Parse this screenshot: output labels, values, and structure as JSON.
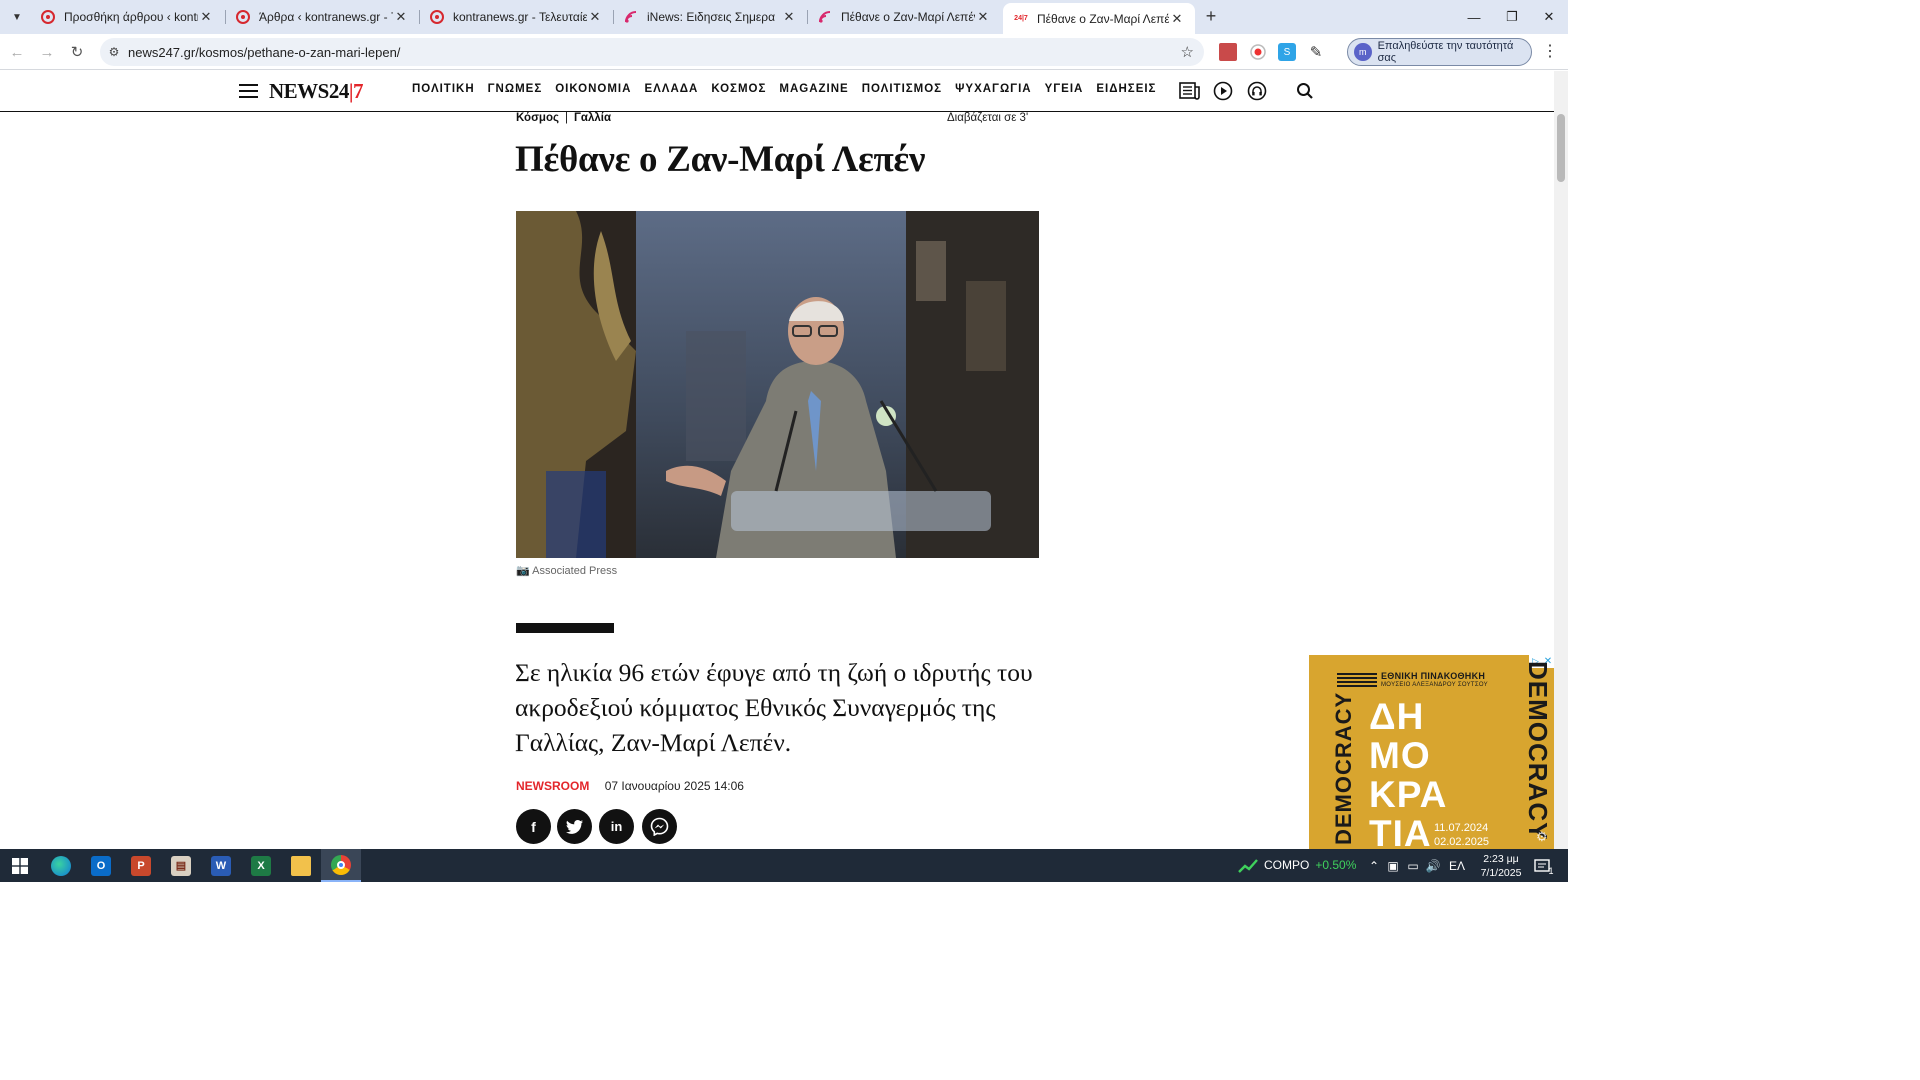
{
  "browser": {
    "tabs": [
      {
        "title": "Προσθήκη άρθρου ‹ kontranews.gr",
        "favicon": "kontranews-icon",
        "active": false
      },
      {
        "title": "Άρθρα ‹ kontranews.gr - Τελευταίες",
        "favicon": "kontranews-icon",
        "active": false
      },
      {
        "title": "kontranews.gr - Τελευταίες ειδήσεις",
        "favicon": "kontranews-icon",
        "active": false
      },
      {
        "title": "iNews: Ειδησεις Σημερα",
        "favicon": "inews-icon",
        "active": false
      },
      {
        "title": "Πέθανε ο Ζαν-Μαρί Λεπέν - ρεπορτάζ",
        "favicon": "inews-icon",
        "active": false
      },
      {
        "title": "Πέθανε ο Ζαν-Μαρί Λεπέν",
        "favicon": "news247-icon",
        "active": true
      }
    ],
    "url": "news247.gr/kosmos/pethane-o-zan-mari-lepen/",
    "verify_identity": "Επαληθεύστε την ταυτότητά σας"
  },
  "site": {
    "logo_main": "NEWS24",
    "logo_accent": "|7",
    "nav": [
      "ΠΟΛΙΤΙΚΗ",
      "ΓΝΩΜΕΣ",
      "ΟΙΚΟΝΟΜΙΑ",
      "ΕΛΛΑΔΑ",
      "ΚΟΣΜΟΣ",
      "MAGAZINE",
      "ΠΟΛΙΤΙΣΜΟΣ",
      "ΨΥΧΑΓΩΓΙΑ",
      "ΥΓΕΙΑ",
      "ΕΙΔΗΣΕΙΣ"
    ]
  },
  "article": {
    "category": "Κόσμος",
    "subcategory": "Γαλλία",
    "read_time": "Διαβάζεται σε 3'",
    "headline": "Πέθανε ο Ζαν-Μαρί Λεπέν",
    "photo_credit": "Associated Press",
    "lead": "Σε ηλικία 96 ετών έφυγε από τη ζωή ο ιδρυτής του ακροδεξιού κόμματος Εθνικός Συναγερμός της Γαλλίας, Ζαν-Μαρί Λεπέν.",
    "author": "NEWSROOM",
    "date": "07 Ιανουαρίου 2025 14:06",
    "share": [
      "facebook",
      "twitter",
      "linkedin",
      "messenger"
    ]
  },
  "ad": {
    "museum_name": "ΕΘΝΙΚΗ ΠΙΝΑΚΟΘΗΚΗ",
    "museum_sub": "ΜΟΥΣΕΙΟ ΑΛΕΞΑΝΔΡΟΥ ΣΟΥΤΣΟΥ",
    "big_lines": [
      "ΔΗ",
      "ΜΟ",
      "ΚΡΑ",
      "ΤΙΑ"
    ],
    "vertical_left": "DEMOCRACY",
    "vertical_right": "DEMOCRACY",
    "date_start": "11.07.2024",
    "date_end": "02.02.2025",
    "accent": "#d8a52f"
  },
  "taskbar": {
    "stock_name": "COMPO",
    "stock_change": "+0.50%",
    "language": "ΕΛ",
    "time": "2:23 μμ",
    "date": "7/1/2025",
    "notifications": "1"
  }
}
